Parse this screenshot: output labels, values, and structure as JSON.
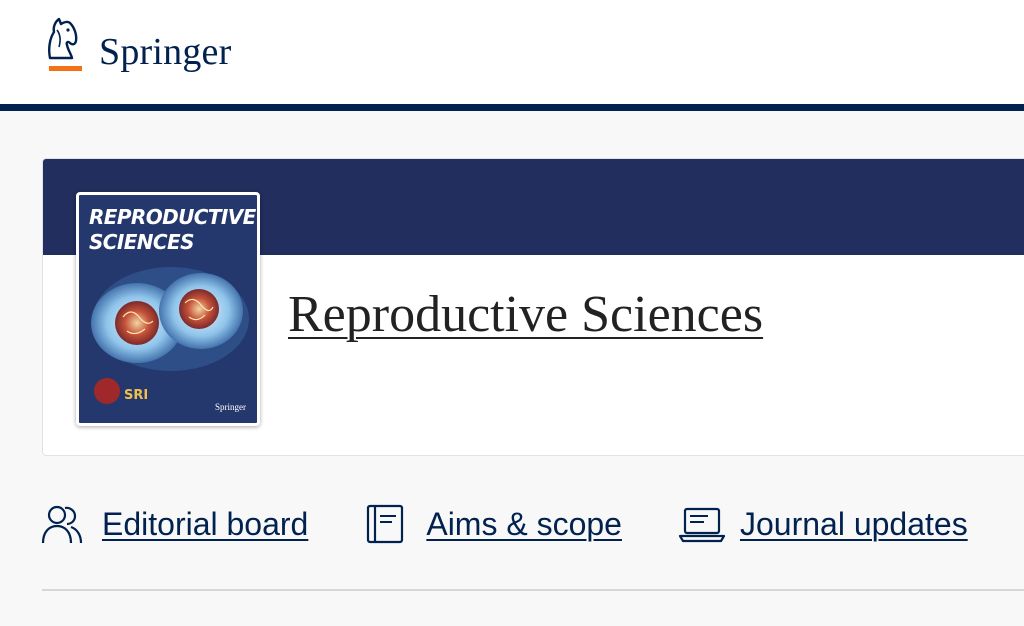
{
  "header": {
    "brand": "Springer",
    "logo_icon": "springer-horse-icon",
    "brand_color": "#01214f",
    "accent_color": "#f47216"
  },
  "journal": {
    "title": "Reproductive Sciences",
    "cover": {
      "title_line1": "REPRODUCTIVE",
      "title_line2": "SCIENCES",
      "society_mark": "SRI",
      "publisher": "Springer"
    },
    "band_color": "#222e5d"
  },
  "nav": {
    "items": [
      {
        "label": "Editorial board",
        "icon": "people-icon"
      },
      {
        "label": "Aims & scope",
        "icon": "book-icon"
      },
      {
        "label": "Journal updates",
        "icon": "laptop-icon"
      }
    ]
  }
}
